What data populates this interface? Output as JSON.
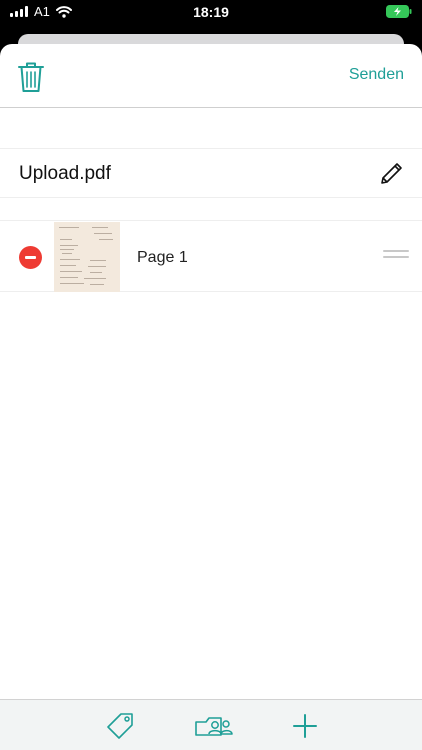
{
  "status_bar": {
    "carrier": "A1",
    "time": "18:19"
  },
  "nav": {
    "send_label": "Senden",
    "trash_icon": "trash-icon"
  },
  "document": {
    "filename": "Upload.pdf",
    "edit_icon": "pencil-icon"
  },
  "pages": [
    {
      "label": "Page 1",
      "remove_icon": "minus-circle-icon",
      "handle_icon": "drag-handle-icon"
    }
  ],
  "toolbar": {
    "items": [
      "tag-icon",
      "contacts-icon",
      "plus-icon"
    ]
  },
  "colors": {
    "accent": "#1f9f97",
    "delete": "#ee3b33",
    "battery": "#35c759"
  }
}
